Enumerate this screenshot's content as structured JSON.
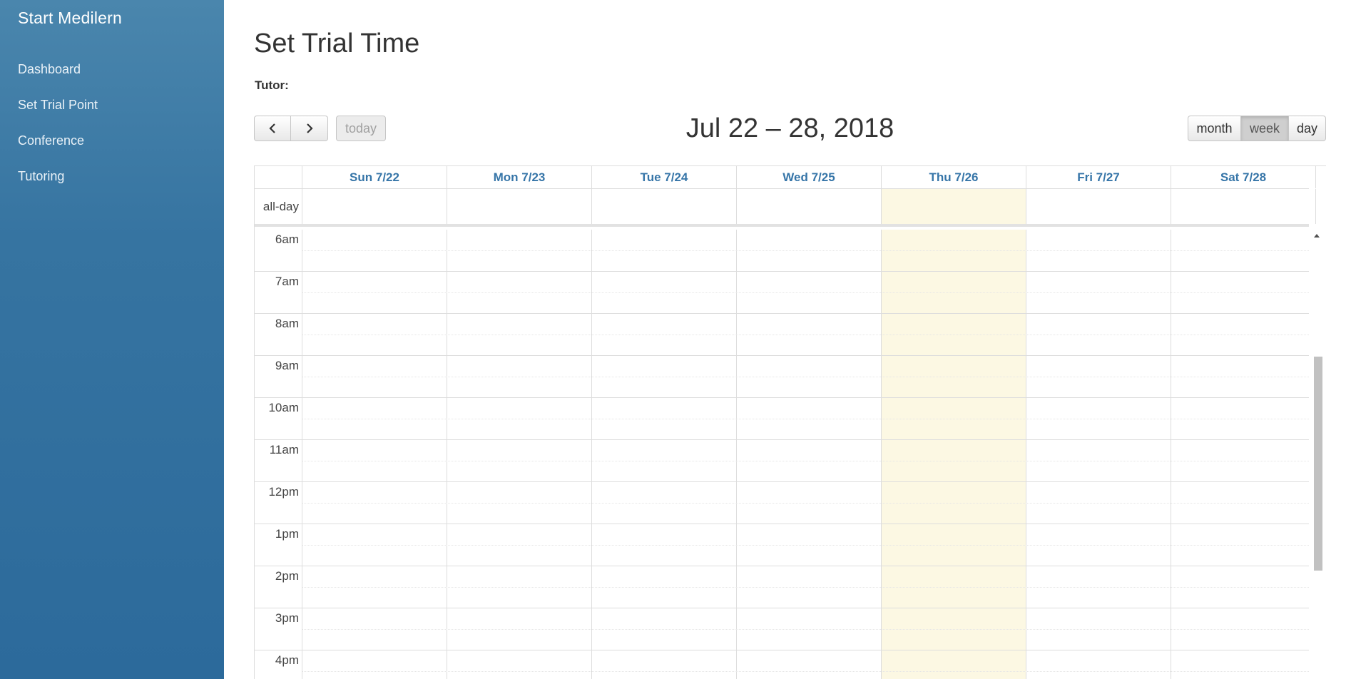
{
  "sidebar": {
    "brand": "Start Medilern",
    "items": [
      {
        "label": "Dashboard"
      },
      {
        "label": "Set Trial Point"
      },
      {
        "label": "Conference"
      },
      {
        "label": "Tutoring"
      }
    ]
  },
  "page": {
    "title": "Set Trial Time",
    "tutor_label": "Tutor:"
  },
  "toolbar": {
    "prev_icon": "chevron-left-icon",
    "next_icon": "chevron-right-icon",
    "today_label": "today",
    "range_title": "Jul 22 – 28, 2018",
    "views": [
      "month",
      "week",
      "day"
    ],
    "active_view": "week"
  },
  "calendar": {
    "allday_label": "all-day",
    "days": [
      "Sun 7/22",
      "Mon 7/23",
      "Tue 7/24",
      "Wed 7/25",
      "Thu 7/26",
      "Fri 7/27",
      "Sat 7/28"
    ],
    "today_index": 4,
    "today_color": "#fcf8e3",
    "hours": [
      "6am",
      "7am",
      "8am",
      "9am",
      "10am",
      "11am",
      "12pm",
      "1pm",
      "2pm",
      "3pm",
      "4pm"
    ]
  },
  "colors": {
    "sidebar_top": "#4a86ad",
    "sidebar_bottom": "#2c6a9b",
    "day_header_text": "#3675a8"
  }
}
